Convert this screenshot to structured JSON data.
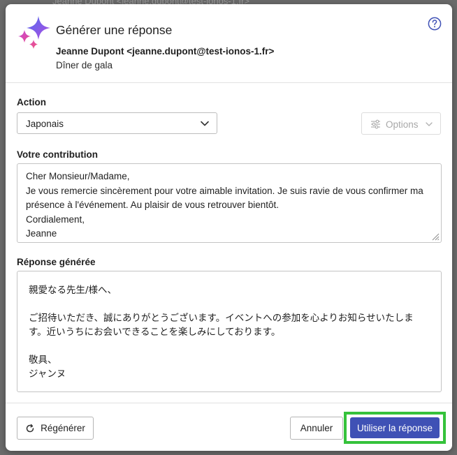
{
  "backdrop": {
    "text": "Jeanne Dupont <jeanne.dupont@test-ionos-1.fr>"
  },
  "header": {
    "title": "Générer une réponse",
    "sender": "Jeanne Dupont <jeanne.dupont@test-ionos-1.fr>",
    "subject": "Dîner de gala",
    "help_icon": "question-circle-icon",
    "logo_icon": "ai-sparkle-icon"
  },
  "action": {
    "label": "Action",
    "selected": "Japonais",
    "options_button": "Options"
  },
  "contribution": {
    "label": "Votre contribution",
    "lines": [
      "Cher Monsieur/Madame,",
      "Je vous remercie sincèrement pour votre aimable invitation. Je suis ravie de vous confirmer ma présence à l'événement. Au plaisir de vous retrouver bientôt.",
      "Cordialement,",
      "Jeanne"
    ]
  },
  "generated": {
    "label": "Réponse générée",
    "paragraphs": [
      "親愛なる先生/様へ、",
      "ご招待いただき、誠にありがとうございます。イベントへの参加を心よりお知らせいたします。近いうちにお会いできることを楽しみにしております。",
      "敬具、",
      "ジャンヌ"
    ]
  },
  "footer": {
    "regenerate": "Régénérer",
    "cancel": "Annuler",
    "use": "Utiliser la réponse"
  },
  "colors": {
    "primary": "#3f51b5",
    "highlight": "#35c23b",
    "sparkle_start": "#4f6bf0",
    "sparkle_end": "#e8458b"
  }
}
